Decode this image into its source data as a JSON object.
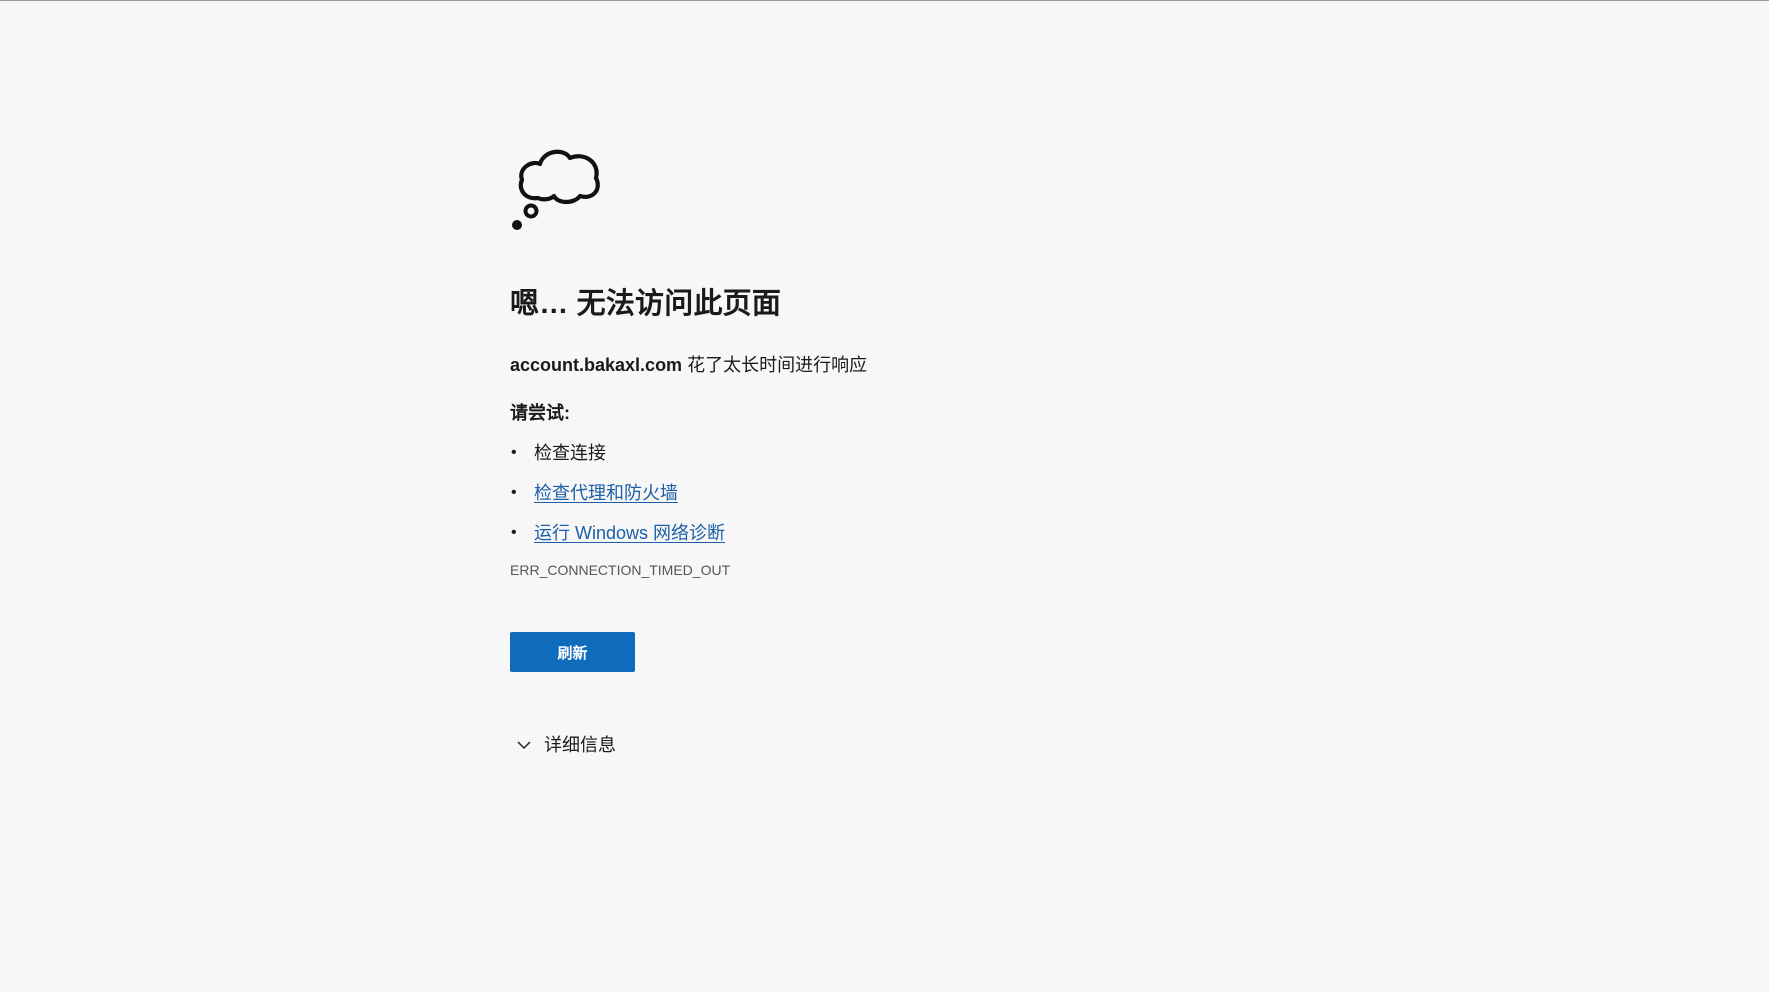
{
  "headline": "嗯… 无法访问此页面",
  "message": {
    "host": "account.bakaxl.com",
    "text": " 花了太长时间进行响应"
  },
  "try_title": "请尝试:",
  "suggestions": [
    {
      "label": "检查连接",
      "is_link": false
    },
    {
      "label": "检查代理和防火墙",
      "is_link": true
    },
    {
      "label": "运行 Windows 网络诊断",
      "is_link": true
    }
  ],
  "bullet": "•",
  "error_code": "ERR_CONNECTION_TIMED_OUT",
  "refresh_label": "刷新",
  "details_label": "详细信息",
  "icons": {
    "main": "thought-cloud-icon",
    "details_toggle": "chevron-down-icon"
  },
  "colors": {
    "background": "#f7f7f7",
    "button": "#0f6cbd",
    "link": "#1d5ea8"
  }
}
